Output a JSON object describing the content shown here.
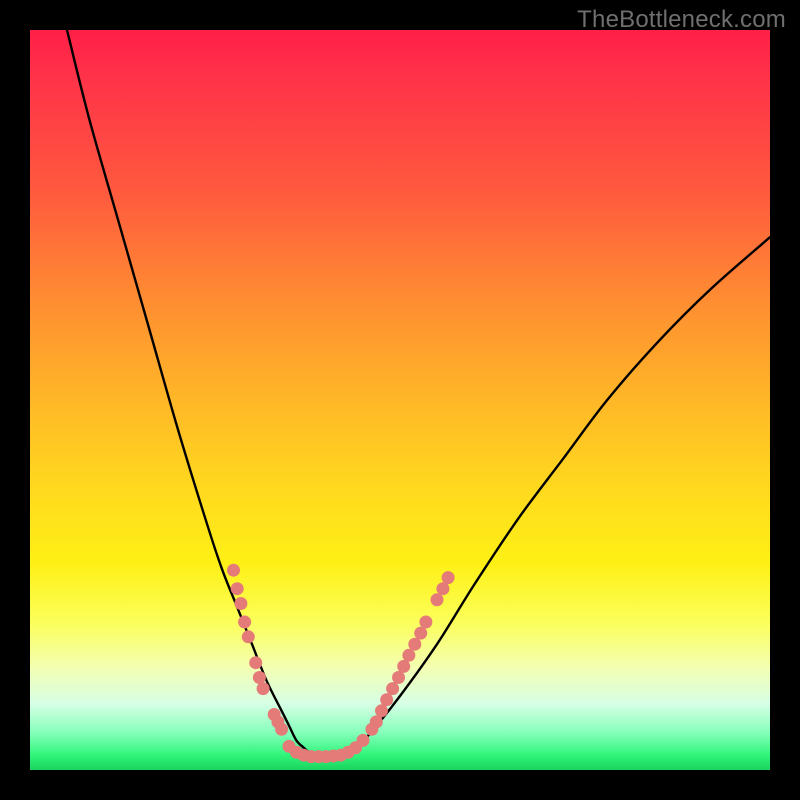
{
  "watermark": "TheBottleneck.com",
  "colors": {
    "frame": "#000000",
    "curve": "#000000",
    "dots": "#e57b78"
  },
  "chart_data": {
    "type": "line",
    "title": "",
    "xlabel": "",
    "ylabel": "",
    "xlim": [
      0,
      100
    ],
    "ylim": [
      0,
      100
    ],
    "grid": false,
    "legend": false,
    "series": [
      {
        "name": "bottleneck-curve",
        "x": [
          5,
          8,
          12,
          16,
          20,
          24,
          26,
          28,
          30,
          32,
          34,
          35,
          36,
          37,
          38,
          39,
          40,
          42,
          44,
          46,
          50,
          55,
          60,
          66,
          72,
          78,
          85,
          92,
          100
        ],
        "y": [
          100,
          88,
          74,
          60,
          46,
          33,
          27,
          22,
          17,
          12,
          8,
          6,
          4,
          3,
          2.2,
          2,
          2,
          2.2,
          3,
          5,
          10,
          17,
          25,
          34,
          42,
          50,
          58,
          65,
          72
        ]
      }
    ],
    "dots": [
      {
        "x": 27.5,
        "y": 27.0
      },
      {
        "x": 28.0,
        "y": 24.5
      },
      {
        "x": 28.5,
        "y": 22.5
      },
      {
        "x": 29.0,
        "y": 20.0
      },
      {
        "x": 29.5,
        "y": 18.0
      },
      {
        "x": 30.5,
        "y": 14.5
      },
      {
        "x": 31.0,
        "y": 12.5
      },
      {
        "x": 31.5,
        "y": 11.0
      },
      {
        "x": 33.0,
        "y": 7.5
      },
      {
        "x": 33.5,
        "y": 6.5
      },
      {
        "x": 34.0,
        "y": 5.5
      },
      {
        "x": 35.0,
        "y": 3.2
      },
      {
        "x": 36.0,
        "y": 2.4
      },
      {
        "x": 37.0,
        "y": 2.0
      },
      {
        "x": 38.0,
        "y": 1.8
      },
      {
        "x": 39.0,
        "y": 1.8
      },
      {
        "x": 40.0,
        "y": 1.8
      },
      {
        "x": 41.0,
        "y": 1.9
      },
      {
        "x": 42.0,
        "y": 2.0
      },
      {
        "x": 43.0,
        "y": 2.4
      },
      {
        "x": 44.0,
        "y": 3.0
      },
      {
        "x": 45.0,
        "y": 4.0
      },
      {
        "x": 46.2,
        "y": 5.5
      },
      {
        "x": 46.8,
        "y": 6.5
      },
      {
        "x": 47.5,
        "y": 8.0
      },
      {
        "x": 48.2,
        "y": 9.5
      },
      {
        "x": 49.0,
        "y": 11.0
      },
      {
        "x": 49.8,
        "y": 12.5
      },
      {
        "x": 50.5,
        "y": 14.0
      },
      {
        "x": 51.2,
        "y": 15.5
      },
      {
        "x": 52.0,
        "y": 17.0
      },
      {
        "x": 52.8,
        "y": 18.5
      },
      {
        "x": 53.5,
        "y": 20.0
      },
      {
        "x": 55.0,
        "y": 23.0
      },
      {
        "x": 55.8,
        "y": 24.5
      },
      {
        "x": 56.5,
        "y": 26.0
      }
    ]
  }
}
